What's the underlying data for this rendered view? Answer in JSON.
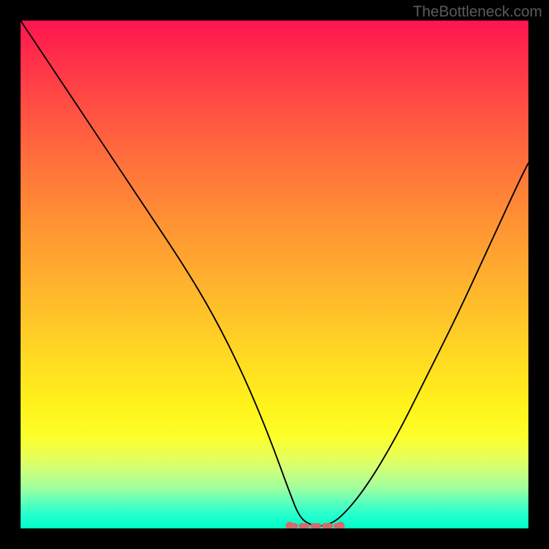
{
  "watermark": "TheBottleneck.com",
  "chart_data": {
    "type": "line",
    "title": "",
    "xlabel": "",
    "ylabel": "",
    "xlim": [
      0,
      100
    ],
    "ylim": [
      0,
      100
    ],
    "grid": false,
    "series": [
      {
        "name": "curve",
        "x": [
          0,
          8,
          16,
          24,
          32,
          38,
          44,
          49,
          53,
          55,
          57.5,
          60,
          63,
          68,
          74,
          80,
          86,
          92,
          98,
          100
        ],
        "values": [
          100,
          88,
          76,
          64,
          52,
          42,
          30,
          18,
          7,
          2,
          0.5,
          0.5,
          2,
          8,
          18,
          30,
          42,
          55,
          68,
          72
        ],
        "note": "Asymmetric V / bottleneck curve. Steeper descent on the left, gentler ascent on the right. Minimum ≈ 0 around x ≈ 57–60."
      }
    ],
    "flat_marker": {
      "x_range": [
        53,
        63
      ],
      "y": 0.5,
      "color": "#d46a6a",
      "note": "Short thick muted-red horizontal dash segment with rounded end-dots at the bottom of the V."
    },
    "background": {
      "type": "vertical-gradient",
      "stops": [
        {
          "pos": 0.0,
          "color": "#ff1450"
        },
        {
          "pos": 0.5,
          "color": "#ffb82c"
        },
        {
          "pos": 0.8,
          "color": "#fff31a"
        },
        {
          "pos": 1.0,
          "color": "#00ffc5"
        }
      ]
    }
  }
}
